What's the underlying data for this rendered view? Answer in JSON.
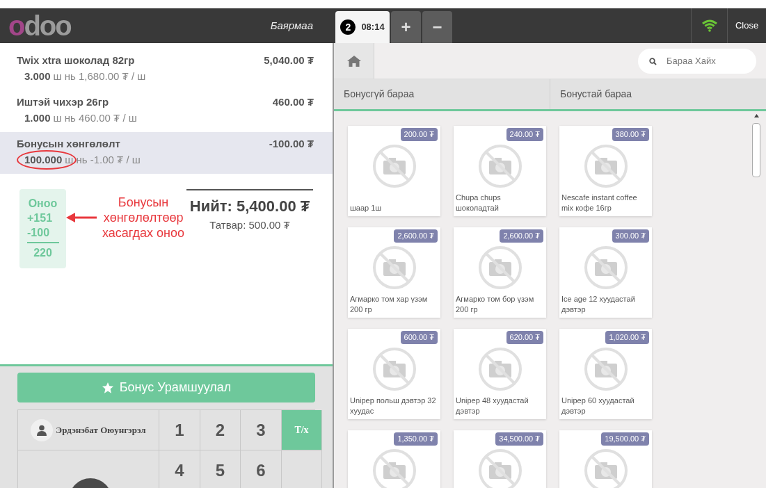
{
  "header": {
    "logo": "odoo",
    "cashier": "Баярмаа",
    "order_tabs": [
      {
        "badge": "2",
        "time": "08:14",
        "selected": true
      }
    ],
    "add_order": "+",
    "remove_order": "−",
    "close": "Close"
  },
  "orderlines": [
    {
      "name": "Twix xtra шоколад 82гр",
      "price": "5,040.00 ₮",
      "qty": "3.000",
      "unit_info": "ш нь 1,680.00 ₮ / ш",
      "selected": false,
      "circled": false
    },
    {
      "name": "Иштэй чихэр 26гр",
      "price": "460.00 ₮",
      "qty": "1.000",
      "unit_info": "ш нь 460.00 ₮ / ш",
      "selected": false,
      "circled": false
    },
    {
      "name": "Бонусын хөнгөлөлт",
      "price": "-100.00 ₮",
      "qty": "100.000",
      "unit_info": "ш нь -1.00 ₮ / ш",
      "selected": true,
      "circled": true
    }
  ],
  "points": {
    "title": "Оноо",
    "earned": "+151",
    "spent": "-100",
    "balance": "220"
  },
  "annotation": {
    "lines": [
      "Бонусын",
      "хөнгөлөлтөөр",
      "хасагдах оноо"
    ]
  },
  "summary": {
    "total": "Нийт: 5,400.00 ₮",
    "tax": "Татвар: 500.00 ₮"
  },
  "bonus_button": "Бонус Урамшуулал",
  "numpad": [
    {
      "kind": "customer",
      "label": "Эрдэнэбат Оюунгэрэл"
    },
    {
      "kind": "digit",
      "label": "1"
    },
    {
      "kind": "digit",
      "label": "2"
    },
    {
      "kind": "digit",
      "label": "3"
    },
    {
      "kind": "mode",
      "label": "Т/х",
      "selected": true
    },
    {
      "kind": "payment"
    },
    {
      "kind": "digit",
      "label": "4"
    },
    {
      "kind": "digit",
      "label": "5"
    },
    {
      "kind": "digit",
      "label": "6"
    },
    {
      "kind": "mode",
      "selected": false
    }
  ],
  "search": {
    "placeholder": "Бараа Хайх"
  },
  "categories": [
    {
      "label": "Бонусгүй бараа"
    },
    {
      "label": "Бонустай бараа"
    }
  ],
  "products": [
    {
      "name": "шаар 1ш",
      "price": "200.00 ₮"
    },
    {
      "name": "Chupa chups шоколадтай",
      "price": "240.00 ₮"
    },
    {
      "name": "Nescafe instant coffee mix кофе 16гр",
      "price": "380.00 ₮"
    },
    {
      "name": "Агмарко том хар үзэм 200 гр",
      "price": "2,600.00 ₮"
    },
    {
      "name": "Агмарко том бор үзэм 200 гр",
      "price": "2,600.00 ₮"
    },
    {
      "name": "Ice age 12 хуудастай дэвтэр",
      "price": "300.00 ₮"
    },
    {
      "name": "Unipep польш дэвтэр 32 хуудас",
      "price": "600.00 ₮"
    },
    {
      "name": "Unipep 48 хуудастай дэвтэр",
      "price": "620.00 ₮"
    },
    {
      "name": "Unipep 60 хуудастай дэвтэр",
      "price": "1,020.00 ₮"
    },
    {
      "price": "1,350.00 ₮"
    },
    {
      "price": "34,500.00 ₮"
    },
    {
      "price": "19,500.00 ₮"
    }
  ]
}
